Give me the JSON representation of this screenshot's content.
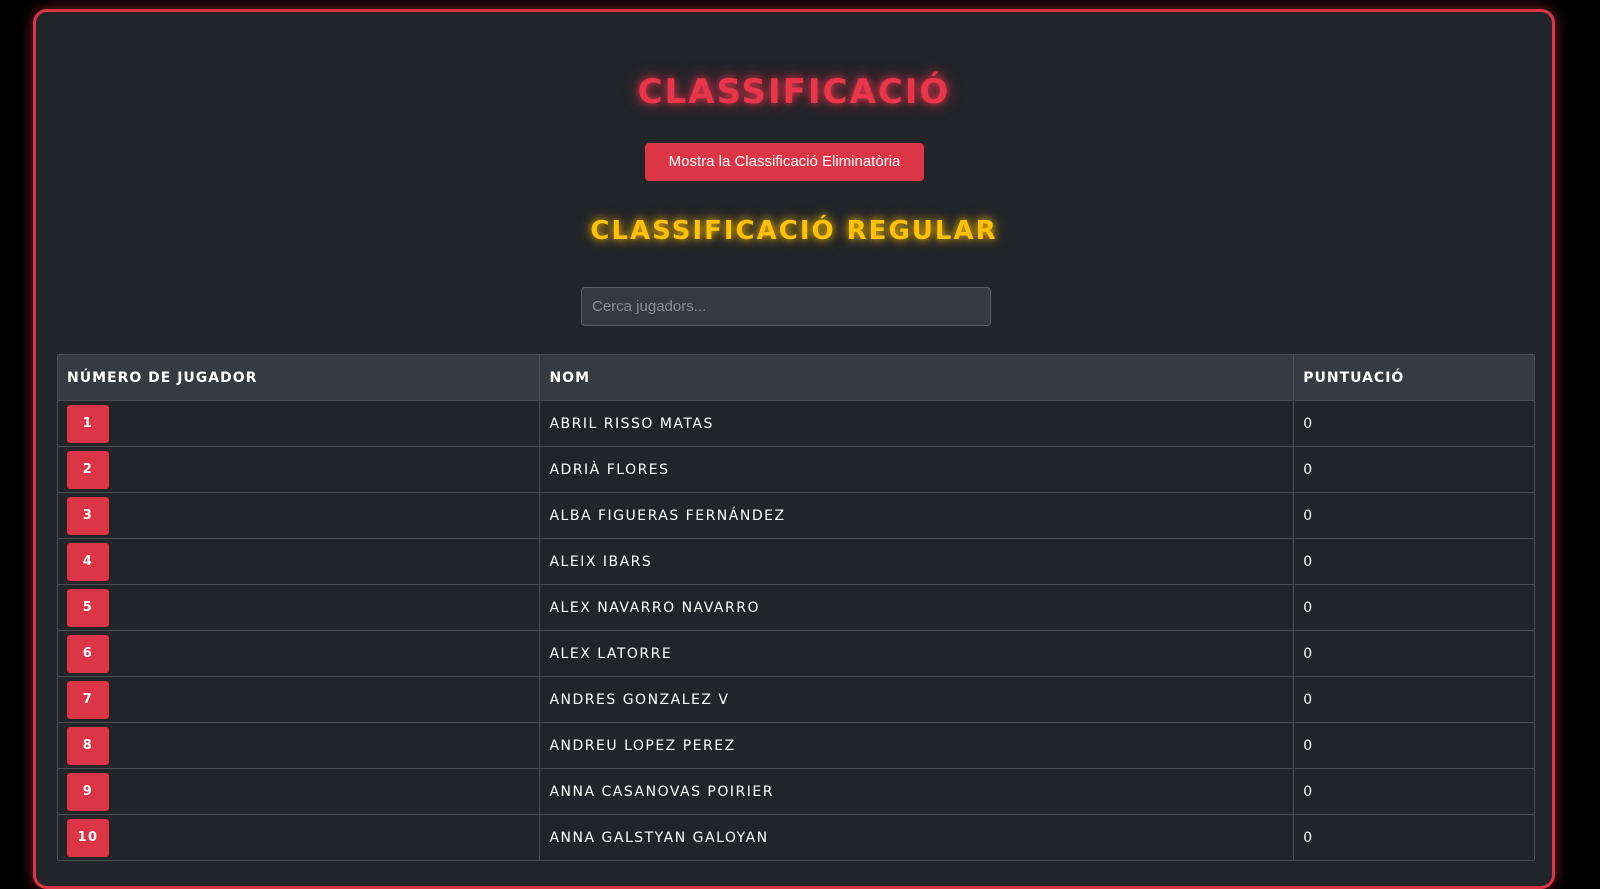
{
  "header": {
    "title": "Classificació",
    "toggle_button": "Mostra la Classificació Eliminatòria",
    "subtitle": "Classificació Regular"
  },
  "search": {
    "placeholder": "Cerca jugadors..."
  },
  "table": {
    "columns": [
      "Número de Jugador",
      "Nom",
      "Puntuació"
    ],
    "rows": [
      {
        "number": "1",
        "name": "Abril Risso Matas",
        "score": "0"
      },
      {
        "number": "2",
        "name": "Adrià Flores",
        "score": "0"
      },
      {
        "number": "3",
        "name": "Alba Figueras Fernández",
        "score": "0"
      },
      {
        "number": "4",
        "name": "Aleix Ibars",
        "score": "0"
      },
      {
        "number": "5",
        "name": "Alex Navarro Navarro",
        "score": "0"
      },
      {
        "number": "6",
        "name": "Alex Latorre",
        "score": "0"
      },
      {
        "number": "7",
        "name": "Andres Gonzalez V",
        "score": "0"
      },
      {
        "number": "8",
        "name": "Andreu Lopez Perez",
        "score": "0"
      },
      {
        "number": "9",
        "name": "Anna Casanovas Poirier",
        "score": "0"
      },
      {
        "number": "10",
        "name": "Anna Galstyan Galoyan",
        "score": "0"
      }
    ]
  },
  "colors": {
    "accent": "#dc3545",
    "subtitle": "#ffc107",
    "background": "#212429"
  }
}
